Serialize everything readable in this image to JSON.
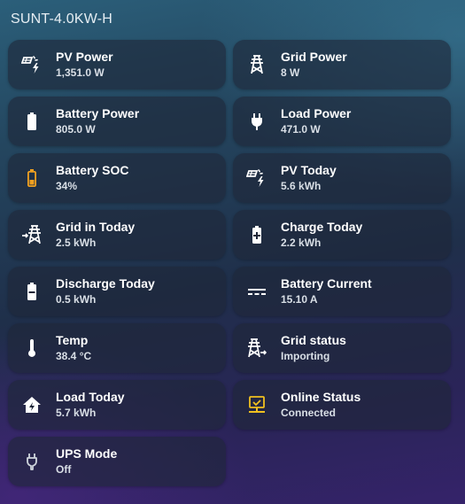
{
  "title": "SUNT-4.0KW-H",
  "colors": {
    "icon_default": "#ffffff",
    "battery_soc": "#f0a020",
    "online": "#f0c020",
    "ups": "#cfd5dc"
  },
  "tiles": [
    {
      "name": "PV Power",
      "state": "1,351.0 W",
      "icon": "solar-power-icon"
    },
    {
      "name": "Grid Power",
      "state": "8 W",
      "icon": "transmission-tower-icon"
    },
    {
      "name": "Battery Power",
      "state": "805.0 W",
      "icon": "battery-icon"
    },
    {
      "name": "Load Power",
      "state": "471.0 W",
      "icon": "power-plug-icon"
    },
    {
      "name": "Battery SOC",
      "state": "34%",
      "icon": "battery-low-icon"
    },
    {
      "name": "PV Today",
      "state": "5.6 kWh",
      "icon": "solar-power-icon"
    },
    {
      "name": "Grid in Today",
      "state": "2.5 kWh",
      "icon": "transmission-tower-import-icon"
    },
    {
      "name": "Charge Today",
      "state": "2.2 kWh",
      "icon": "battery-charging-icon"
    },
    {
      "name": "Discharge Today",
      "state": "0.5 kWh",
      "icon": "battery-discharge-icon"
    },
    {
      "name": "Battery Current",
      "state": "15.10 A",
      "icon": "current-dc-icon"
    },
    {
      "name": "Temp",
      "state": "38.4 °C",
      "icon": "thermometer-icon"
    },
    {
      "name": "Grid status",
      "state": "Importing",
      "icon": "transmission-tower-export-icon"
    },
    {
      "name": "Load Today",
      "state": "5.7 kWh",
      "icon": "home-lightning-icon"
    },
    {
      "name": "Online Status",
      "state": "Connected",
      "icon": "monitor-check-icon"
    },
    {
      "name": "UPS Mode",
      "state": "Off",
      "icon": "power-plug-off-icon"
    }
  ]
}
